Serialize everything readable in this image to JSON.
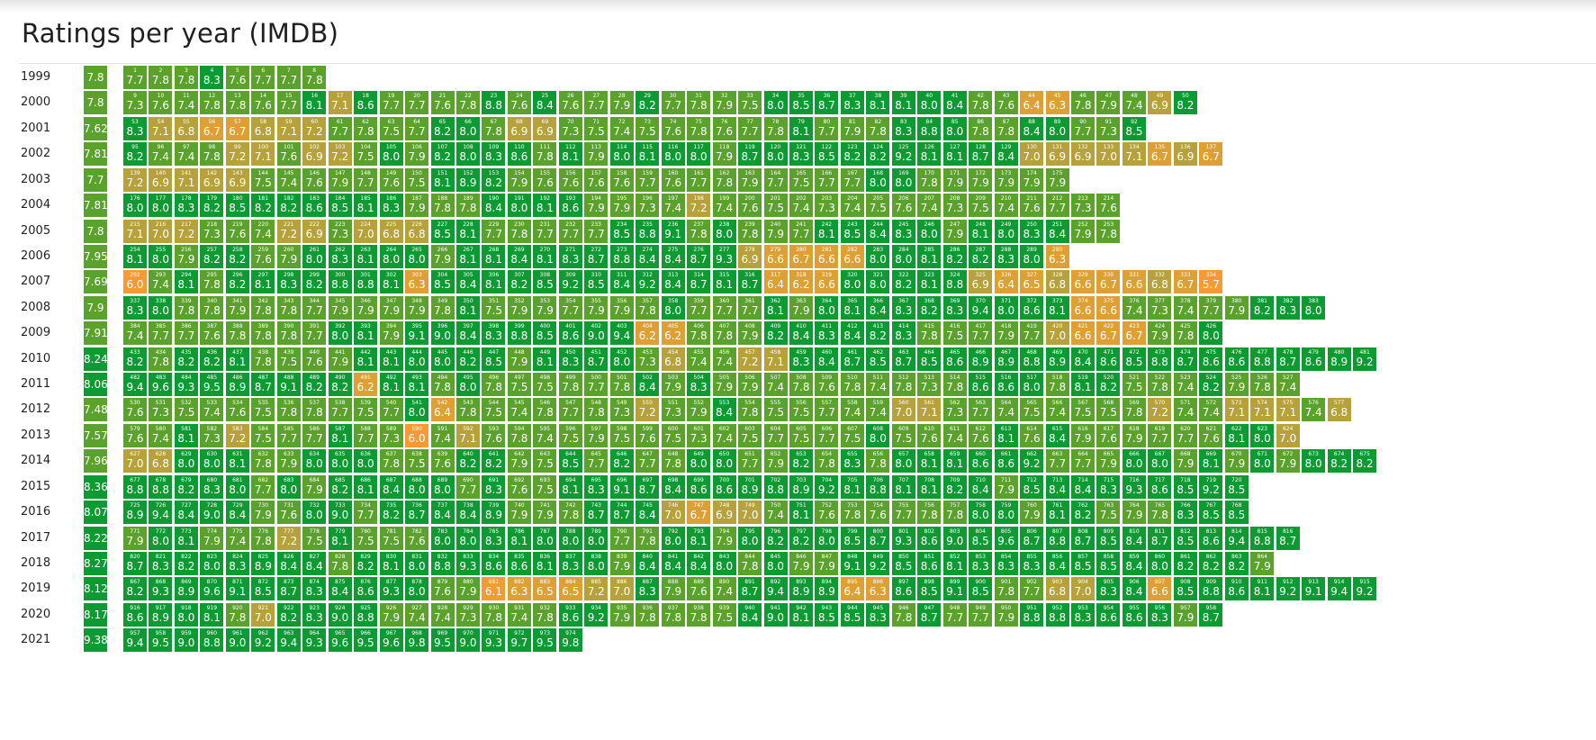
{
  "title": "Ratings per year (IMDB)",
  "chart_data": {
    "type": "heatmap",
    "title": "Ratings per year (IMDB)",
    "colors": {
      "high": "#0c9a32",
      "mid": "#5aa22c",
      "low": "#b6a13a",
      "lower": "#dea032",
      "lowest": "#f79a31"
    },
    "rows": [
      {
        "year": "1999",
        "average": "7.8",
        "start": 1,
        "ratings": [
          "7.7",
          "7.8",
          "7.8",
          "8.3",
          "7.6",
          "7.7",
          "7.7",
          "7.8"
        ]
      },
      {
        "year": "2000",
        "average": "7.8",
        "start": 9,
        "ratings": [
          "7.3",
          "7.6",
          "7.4",
          "7.8",
          "7.8",
          "7.6",
          "7.7",
          "8.1",
          "7.1",
          "8.6",
          "7.7",
          "7.7",
          "7.6",
          "7.8",
          "8.8",
          "7.6",
          "8.4",
          "7.6",
          "7.7",
          "7.9",
          "8.2",
          "7.7",
          "7.8",
          "7.9",
          "7.5",
          "8.0",
          "8.5",
          "8.7",
          "8.3",
          "8.1",
          "8.1",
          "8.0",
          "8.4",
          "7.8",
          "7.6",
          "6.4",
          "6.3",
          "7.8",
          "7.9",
          "7.4",
          "6.9",
          "8.2"
        ]
      },
      {
        "year": "2001",
        "average": "7.62",
        "start": 53,
        "ratings": [
          "8.3",
          "7.1",
          "6.8",
          "6.7",
          "6.7",
          "6.8",
          "7.1",
          "7.2",
          "7.7",
          "7.8",
          "7.5",
          "7.7",
          "8.2",
          "8.0",
          "7.8",
          "6.9",
          "6.9",
          "7.3",
          "7.5",
          "7.4",
          "7.5",
          "7.6",
          "7.8",
          "7.6",
          "7.7",
          "7.8",
          "8.1",
          "7.7",
          "7.9",
          "7.8",
          "8.3",
          "8.8",
          "8.0",
          "7.8",
          "7.8",
          "8.4",
          "8.0",
          "7.7",
          "7.3",
          "8.5"
        ]
      },
      {
        "year": "2002",
        "average": "7.81",
        "start": 95,
        "ratings": [
          "8.2",
          "7.4",
          "7.4",
          "7.8",
          "7.2",
          "7.1",
          "7.6",
          "6.9",
          "7.2",
          "7.5",
          "8.0",
          "7.9",
          "8.2",
          "8.0",
          "8.3",
          "8.6",
          "7.8",
          "8.1",
          "7.9",
          "8.0",
          "8.1",
          "8.0",
          "8.0",
          "7.9",
          "8.7",
          "8.0",
          "8.3",
          "8.5",
          "8.2",
          "8.2",
          "9.2",
          "8.1",
          "8.1",
          "8.7",
          "8.4",
          "7.0",
          "6.9",
          "6.9",
          "7.0",
          "7.1",
          "6.7",
          "6.9",
          "6.7"
        ]
      },
      {
        "year": "2003",
        "average": "7.7",
        "start": 139,
        "ratings": [
          "7.2",
          "6.9",
          "7.1",
          "6.9",
          "6.9",
          "7.5",
          "7.4",
          "7.6",
          "7.9",
          "7.7",
          "7.6",
          "7.5",
          "8.1",
          "8.9",
          "8.2",
          "7.9",
          "7.6",
          "7.6",
          "7.6",
          "7.6",
          "7.7",
          "7.6",
          "7.7",
          "7.8",
          "7.9",
          "7.7",
          "7.5",
          "7.7",
          "7.7",
          "8.0",
          "8.0",
          "7.8",
          "7.9",
          "7.9",
          "7.9",
          "7.9",
          "7.9"
        ]
      },
      {
        "year": "2004",
        "average": "7.81",
        "start": 176,
        "ratings": [
          "8.0",
          "8.0",
          "8.3",
          "8.2",
          "8.5",
          "8.2",
          "8.2",
          "8.6",
          "8.5",
          "8.1",
          "8.3",
          "7.9",
          "7.8",
          "7.8",
          "8.4",
          "8.0",
          "8.1",
          "8.6",
          "7.9",
          "7.9",
          "7.3",
          "7.4",
          "7.2",
          "7.4",
          "7.6",
          "7.5",
          "7.4",
          "7.3",
          "7.4",
          "7.5",
          "7.6",
          "7.4",
          "7.3",
          "7.5",
          "7.4",
          "7.6",
          "7.7",
          "7.3",
          "7.6"
        ]
      },
      {
        "year": "2005",
        "average": "7.8",
        "start": 215,
        "ratings": [
          "7.1",
          "7.0",
          "7.2",
          "7.3",
          "7.6",
          "7.4",
          "7.2",
          "6.9",
          "7.3",
          "7.0",
          "6.8",
          "6.8",
          "8.5",
          "8.1",
          "7.7",
          "7.8",
          "7.7",
          "7.7",
          "7.7",
          "8.5",
          "8.8",
          "9.1",
          "7.8",
          "8.0",
          "7.8",
          "7.9",
          "7.7",
          "8.1",
          "8.5",
          "8.4",
          "8.3",
          "8.0",
          "7.9",
          "8.1",
          "8.0",
          "8.3",
          "8.4",
          "7.9",
          "7.8"
        ]
      },
      {
        "year": "2006",
        "average": "7.95",
        "start": 254,
        "ratings": [
          "8.1",
          "8.0",
          "7.9",
          "8.2",
          "8.2",
          "7.6",
          "7.9",
          "8.0",
          "8.3",
          "8.1",
          "8.0",
          "8.0",
          "7.9",
          "8.1",
          "8.1",
          "8.4",
          "8.1",
          "8.3",
          "8.7",
          "8.8",
          "8.4",
          "8.4",
          "8.7",
          "9.3",
          "6.9",
          "6.6",
          "6.7",
          "6.6",
          "6.6",
          "8.0",
          "8.0",
          "8.1",
          "8.2",
          "8.2",
          "8.3",
          "8.0",
          "6.3"
        ]
      },
      {
        "year": "2007",
        "average": "7.69",
        "start": 292,
        "ratings": [
          "6.0",
          "7.4",
          "8.1",
          "7.8",
          "8.2",
          "8.1",
          "8.3",
          "8.2",
          "8.8",
          "8.8",
          "8.1",
          "6.3",
          "8.5",
          "8.4",
          "8.1",
          "8.2",
          "8.5",
          "9.2",
          "8.5",
          "8.4",
          "9.2",
          "8.4",
          "8.7",
          "8.1",
          "8.7",
          "6.4",
          "6.2",
          "6.6",
          "8.0",
          "8.0",
          "8.2",
          "8.1",
          "8.8",
          "6.9",
          "6.4",
          "6.5",
          "6.8",
          "6.6",
          "6.7",
          "6.6",
          "6.8",
          "6.7",
          "5.7"
        ]
      },
      {
        "year": "2008",
        "average": "7.9",
        "start": 337,
        "ratings": [
          "8.3",
          "8.0",
          "7.8",
          "7.8",
          "7.9",
          "7.8",
          "7.8",
          "7.7",
          "7.9",
          "7.9",
          "7.9",
          "7.9",
          "7.8",
          "8.1",
          "7.5",
          "7.9",
          "7.9",
          "7.7",
          "7.9",
          "7.9",
          "7.8",
          "8.0",
          "7.7",
          "7.7",
          "7.7",
          "8.1",
          "7.9",
          "8.0",
          "8.1",
          "8.4",
          "8.3",
          "8.2",
          "8.3",
          "9.4",
          "8.0",
          "8.6",
          "8.1",
          "6.6",
          "6.6",
          "7.4",
          "7.3",
          "7.4",
          "7.7",
          "7.9",
          "8.2",
          "8.3",
          "8.0"
        ]
      },
      {
        "year": "2009",
        "average": "7.91",
        "start": 384,
        "ratings": [
          "7.4",
          "7.7",
          "7.7",
          "7.6",
          "7.8",
          "7.8",
          "7.8",
          "7.7",
          "8.0",
          "8.1",
          "7.9",
          "9.1",
          "9.0",
          "8.4",
          "8.3",
          "8.8",
          "8.5",
          "8.6",
          "9.0",
          "9.4",
          "6.2",
          "6.2",
          "7.8",
          "7.8",
          "7.9",
          "8.2",
          "8.4",
          "8.3",
          "8.4",
          "8.2",
          "8.3",
          "7.8",
          "7.5",
          "7.7",
          "7.9",
          "7.7",
          "7.0",
          "6.6",
          "6.7",
          "6.7",
          "7.9",
          "7.8",
          "8.0"
        ]
      },
      {
        "year": "2010",
        "average": "8.24",
        "start": 433,
        "ratings": [
          "8.2",
          "7.8",
          "8.2",
          "8.2",
          "8.1",
          "7.8",
          "7.5",
          "7.6",
          "7.9",
          "8.1",
          "8.1",
          "8.0",
          "8.0",
          "8.2",
          "8.5",
          "7.9",
          "8.1",
          "8.3",
          "8.7",
          "8.0",
          "7.3",
          "6.8",
          "7.4",
          "7.4",
          "7.2",
          "7.1",
          "8.3",
          "8.4",
          "8.7",
          "8.5",
          "8.7",
          "8.5",
          "8.6",
          "8.9",
          "8.9",
          "8.8",
          "8.9",
          "8.4",
          "8.6",
          "8.5",
          "8.8",
          "8.7",
          "8.6",
          "8.6",
          "8.8",
          "8.7",
          "8.6",
          "8.9",
          "9.2"
        ]
      },
      {
        "year": "2011",
        "average": "8.06",
        "start": 482,
        "ratings": [
          "9.4",
          "9.6",
          "9.3",
          "9.5",
          "8.9",
          "8.7",
          "9.1",
          "8.2",
          "8.2",
          "6.2",
          "8.1",
          "8.1",
          "7.8",
          "8.0",
          "7.8",
          "7.5",
          "7.5",
          "7.8",
          "7.7",
          "7.8",
          "8.4",
          "7.9",
          "8.3",
          "7.9",
          "7.9",
          "7.4",
          "7.8",
          "7.6",
          "7.8",
          "7.4",
          "7.8",
          "7.3",
          "7.8",
          "8.6",
          "8.6",
          "8.0",
          "7.8",
          "8.1",
          "8.2",
          "7.5",
          "7.8",
          "7.4",
          "8.2",
          "7.9",
          "7.8",
          "7.4"
        ]
      },
      {
        "year": "2012",
        "average": "7.48",
        "start": 530,
        "ratings": [
          "7.6",
          "7.3",
          "7.5",
          "7.4",
          "7.6",
          "7.5",
          "7.8",
          "7.8",
          "7.7",
          "7.5",
          "7.7",
          "8.0",
          "6.4",
          "7.8",
          "7.5",
          "7.4",
          "7.8",
          "7.7",
          "7.8",
          "7.3",
          "7.2",
          "7.3",
          "7.9",
          "8.4",
          "7.8",
          "7.5",
          "7.5",
          "7.7",
          "7.4",
          "7.4",
          "7.0",
          "7.1",
          "7.3",
          "7.7",
          "7.4",
          "7.5",
          "7.4",
          "7.5",
          "7.5",
          "7.8",
          "7.2",
          "7.4",
          "7.4",
          "7.1",
          "7.1",
          "7.1",
          "7.4",
          "6.8"
        ]
      },
      {
        "year": "2013",
        "average": "7.57",
        "start": 579,
        "ratings": [
          "7.6",
          "7.4",
          "8.1",
          "7.3",
          "7.2",
          "7.5",
          "7.7",
          "7.7",
          "8.1",
          "7.7",
          "7.3",
          "6.0",
          "7.4",
          "7.1",
          "7.6",
          "7.8",
          "7.4",
          "7.5",
          "7.9",
          "7.5",
          "7.6",
          "7.5",
          "7.3",
          "7.4",
          "7.5",
          "7.7",
          "7.5",
          "7.7",
          "7.5",
          "8.0",
          "7.5",
          "7.6",
          "7.4",
          "7.6",
          "8.1",
          "7.6",
          "8.4",
          "7.9",
          "7.6",
          "7.9",
          "7.7",
          "7.7",
          "7.6",
          "8.1",
          "8.0",
          "7.0"
        ]
      },
      {
        "year": "2014",
        "average": "7.96",
        "start": 627,
        "ratings": [
          "7.0",
          "6.8",
          "8.0",
          "8.0",
          "8.1",
          "7.8",
          "7.9",
          "8.0",
          "8.0",
          "8.0",
          "7.8",
          "7.5",
          "7.6",
          "8.2",
          "8.2",
          "7.9",
          "7.5",
          "8.5",
          "7.7",
          "8.2",
          "7.7",
          "7.8",
          "8.0",
          "8.0",
          "7.7",
          "7.9",
          "8.2",
          "7.8",
          "8.3",
          "7.8",
          "8.0",
          "8.1",
          "8.1",
          "8.6",
          "8.6",
          "9.2",
          "7.7",
          "7.7",
          "7.9",
          "8.0",
          "8.0",
          "7.9",
          "8.1",
          "7.9",
          "8.0",
          "7.9",
          "8.0",
          "8.2",
          "8.2"
        ]
      },
      {
        "year": "2015",
        "average": "8.36",
        "start": 677,
        "ratings": [
          "8.8",
          "8.8",
          "8.2",
          "8.3",
          "8.0",
          "7.7",
          "8.0",
          "7.9",
          "8.2",
          "8.1",
          "8.4",
          "8.0",
          "8.0",
          "7.7",
          "8.3",
          "7.6",
          "7.5",
          "8.1",
          "8.3",
          "9.1",
          "8.7",
          "8.4",
          "8.6",
          "8.6",
          "8.9",
          "8.8",
          "8.9",
          "9.2",
          "8.1",
          "8.8",
          "8.1",
          "8.1",
          "8.2",
          "8.4",
          "7.9",
          "8.5",
          "8.4",
          "8.4",
          "8.3",
          "9.3",
          "8.6",
          "8.5",
          "9.2",
          "8.5"
        ]
      },
      {
        "year": "2016",
        "average": "8.07",
        "start": 725,
        "ratings": [
          "8.9",
          "9.4",
          "8.4",
          "9.0",
          "8.4",
          "7.9",
          "7.6",
          "8.0",
          "9.0",
          "7.7",
          "8.2",
          "8.7",
          "8.4",
          "8.4",
          "8.9",
          "7.9",
          "7.9",
          "7.8",
          "8.7",
          "8.7",
          "8.4",
          "7.0",
          "6.7",
          "6.9",
          "7.0",
          "7.4",
          "8.1",
          "7.6",
          "7.8",
          "7.6",
          "7.7",
          "7.8",
          "7.8",
          "8.0",
          "8.0",
          "7.9",
          "8.1",
          "8.2",
          "7.5",
          "7.9",
          "7.8",
          "8.3",
          "8.5",
          "8.5"
        ]
      },
      {
        "year": "2017",
        "average": "8.22",
        "start": 771,
        "ratings": [
          "7.9",
          "8.0",
          "8.1",
          "7.9",
          "7.4",
          "7.8",
          "7.2",
          "7.5",
          "8.1",
          "7.5",
          "7.5",
          "7.6",
          "8.0",
          "8.0",
          "8.3",
          "8.1",
          "8.0",
          "8.0",
          "8.0",
          "7.7",
          "7.8",
          "8.0",
          "8.1",
          "7.9",
          "8.0",
          "8.2",
          "8.2",
          "8.0",
          "8.5",
          "8.7",
          "9.3",
          "8.6",
          "9.0",
          "8.5",
          "9.6",
          "8.7",
          "8.8",
          "8.7",
          "8.5",
          "8.4",
          "8.7",
          "8.5",
          "8.6",
          "9.4",
          "8.8",
          "8.7"
        ]
      },
      {
        "year": "2018",
        "average": "8.27",
        "start": 820,
        "ratings": [
          "8.7",
          "8.3",
          "8.2",
          "8.0",
          "8.3",
          "8.9",
          "8.4",
          "8.4",
          "7.8",
          "8.2",
          "8.1",
          "8.0",
          "8.8",
          "9.3",
          "8.6",
          "8.6",
          "8.1",
          "8.3",
          "8.0",
          "7.9",
          "8.4",
          "8.4",
          "8.4",
          "8.0",
          "7.8",
          "8.0",
          "7.9",
          "7.9",
          "9.1",
          "9.2",
          "8.5",
          "8.6",
          "8.1",
          "8.3",
          "8.3",
          "8.3",
          "8.4",
          "8.5",
          "8.5",
          "8.4",
          "8.0",
          "8.2",
          "8.2",
          "8.2",
          "7.9"
        ]
      },
      {
        "year": "2019",
        "average": "8.12",
        "start": 867,
        "ratings": [
          "8.2",
          "9.3",
          "8.9",
          "9.6",
          "9.1",
          "8.5",
          "8.7",
          "8.3",
          "8.4",
          "8.6",
          "9.3",
          "8.0",
          "7.6",
          "7.9",
          "6.1",
          "6.3",
          "6.5",
          "6.5",
          "7.2",
          "7.0",
          "8.3",
          "7.9",
          "7.6",
          "7.4",
          "8.7",
          "9.4",
          "8.9",
          "8.9",
          "6.4",
          "6.3",
          "8.6",
          "8.5",
          "9.1",
          "8.5",
          "7.8",
          "7.7",
          "6.8",
          "7.0",
          "8.3",
          "8.4",
          "6.6",
          "8.5",
          "8.8",
          "8.6",
          "8.1",
          "9.2",
          "9.1",
          "9.4",
          "9.2"
        ]
      },
      {
        "year": "2020",
        "average": "8.17",
        "start": 916,
        "ratings": [
          "8.6",
          "8.9",
          "8.0",
          "8.1",
          "7.8",
          "7.0",
          "8.2",
          "8.3",
          "9.0",
          "8.8",
          "7.9",
          "7.4",
          "7.4",
          "7.3",
          "7.8",
          "7.4",
          "7.8",
          "8.6",
          "9.2",
          "7.9",
          "7.8",
          "7.8",
          "7.8",
          "7.5",
          "8.4",
          "9.0",
          "8.1",
          "8.5",
          "8.5",
          "8.3",
          "7.8",
          "8.7",
          "7.7",
          "7.7",
          "7.9",
          "8.8",
          "8.8",
          "8.3",
          "8.6",
          "8.6",
          "8.3",
          "7.9",
          "8.7"
        ]
      },
      {
        "year": "2021",
        "average": "9.38",
        "start": 957,
        "ratings": [
          "9.4",
          "9.5",
          "9.0",
          "8.8",
          "9.0",
          "9.2",
          "9.4",
          "9.3",
          "9.6",
          "9.5",
          "9.6",
          "9.8",
          "9.5",
          "9.0",
          "9.3",
          "9.7",
          "9.5",
          "9.8"
        ]
      }
    ]
  }
}
